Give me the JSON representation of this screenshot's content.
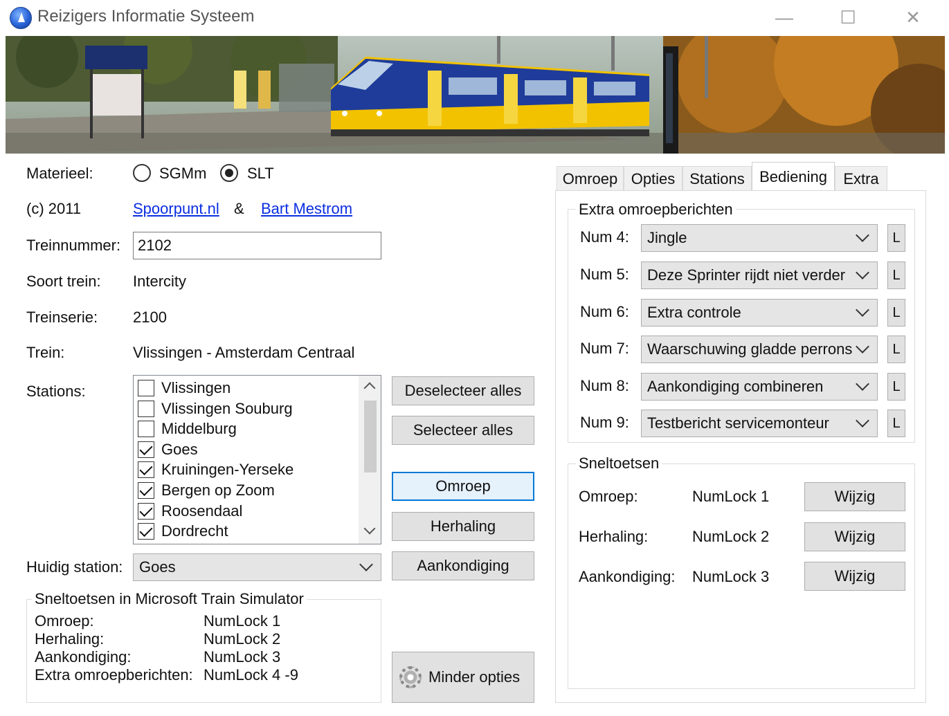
{
  "window": {
    "title": "Reizigers Informatie Systeem",
    "controls": {
      "minimize": "—",
      "maximize": "☐",
      "close": "✕"
    }
  },
  "form": {
    "materieel_label": "Materieel:",
    "materieel_options": [
      {
        "label": "SGMm",
        "checked": false
      },
      {
        "label": "SLT",
        "checked": true
      }
    ],
    "copyright": "(c) 2011",
    "link1": "Spoorpunt.nl",
    "amp": "&",
    "link2": "Bart Mestrom",
    "treinnummer_label": "Treinnummer:",
    "treinnummer_value": "2102",
    "soort_label": "Soort trein:",
    "soort_value": "Intercity",
    "serie_label": "Treinserie:",
    "serie_value": "2100",
    "trein_label": "Trein:",
    "trein_value": "Vlissingen - Amsterdam Centraal",
    "stations_label": "Stations:",
    "stations": [
      {
        "name": "Vlissingen",
        "checked": false
      },
      {
        "name": "Vlissingen Souburg",
        "checked": false
      },
      {
        "name": "Middelburg",
        "checked": false
      },
      {
        "name": "Goes",
        "checked": true
      },
      {
        "name": "Kruiningen-Yerseke",
        "checked": true
      },
      {
        "name": "Bergen op Zoom",
        "checked": true
      },
      {
        "name": "Roosendaal",
        "checked": true
      },
      {
        "name": "Dordrecht",
        "checked": true
      }
    ],
    "huidig_label": "Huidig station:",
    "huidig_value": "Goes"
  },
  "buttons": {
    "deselect": "Deselecteer alles",
    "select": "Selecteer alles",
    "omroep": "Omroep",
    "herhaling": "Herhaling",
    "aankondiging": "Aankondiging",
    "minder": "Minder opties"
  },
  "mts_group": {
    "title": "Sneltoetsen in Microsoft Train Simulator",
    "rows": [
      {
        "label": "Omroep:",
        "key": "NumLock 1"
      },
      {
        "label": "Herhaling:",
        "key": "NumLock 2"
      },
      {
        "label": "Aankondiging:",
        "key": "NumLock 3"
      },
      {
        "label": "Extra omroepberichten:",
        "key": "NumLock 4 -9"
      }
    ]
  },
  "tabs": [
    "Omroep",
    "Opties",
    "Stations",
    "Bediening",
    "Extra"
  ],
  "active_tab": "Bediening",
  "extra_group": {
    "title": "Extra omroepberichten",
    "rows": [
      {
        "label": "Num 4:",
        "value": "Jingle",
        "l": "L"
      },
      {
        "label": "Num 5:",
        "value": "Deze Sprinter rijdt niet verder",
        "l": "L"
      },
      {
        "label": "Num 6:",
        "value": "Extra controle",
        "l": "L"
      },
      {
        "label": "Num 7:",
        "value": "Waarschuwing gladde perrons",
        "l": "L"
      },
      {
        "label": "Num 8:",
        "value": "Aankondiging combineren",
        "l": "L"
      },
      {
        "label": "Num 9:",
        "value": "Testbericht servicemonteur",
        "l": "L"
      }
    ]
  },
  "hotkeys_group": {
    "title": "Sneltoetsen",
    "rows": [
      {
        "label": "Omroep:",
        "key": "NumLock 1",
        "button": "Wijzig"
      },
      {
        "label": "Herhaling:",
        "key": "NumLock 2",
        "button": "Wijzig"
      },
      {
        "label": "Aankondiging:",
        "key": "NumLock 3",
        "button": "Wijzig"
      }
    ]
  },
  "colors": {
    "link": "#0a2ee0",
    "focus_border": "#0078d7",
    "train_yellow": "#f2c200",
    "train_blue": "#1f3c9a"
  },
  "icons": [
    "app-icon",
    "radio-icon",
    "checkbox-icon",
    "chevron-down-icon",
    "scroll-up-icon",
    "scroll-down-icon",
    "gear-icon"
  ]
}
